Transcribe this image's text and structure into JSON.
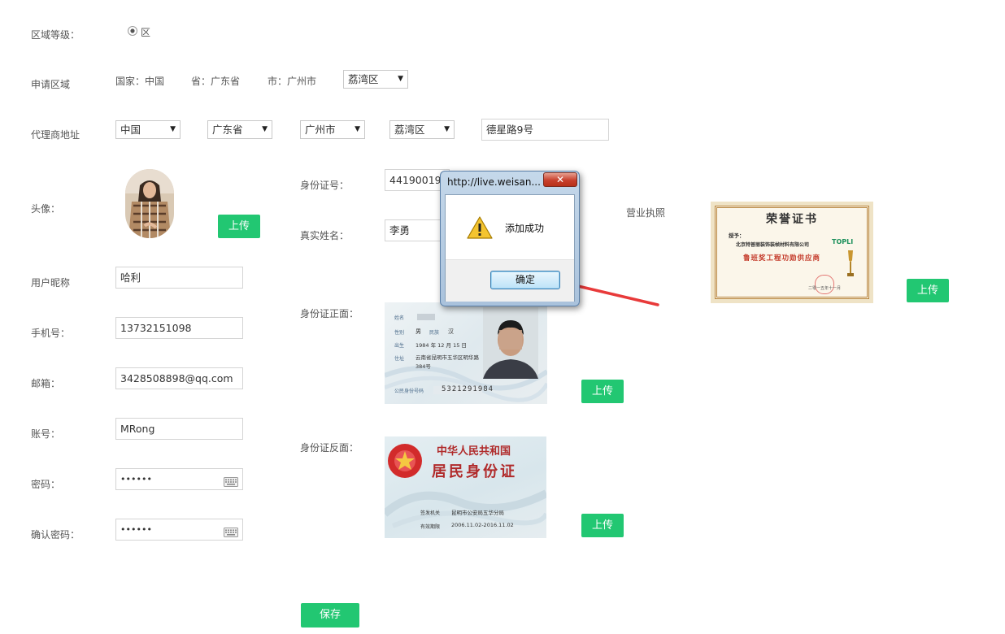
{
  "form": {
    "region_level_label": "区域等级：",
    "region_level_option": "区",
    "apply_region_label": "申请区域",
    "apply_country": "国家：中国",
    "apply_province": "省：广东省",
    "apply_city": "市：广州市",
    "apply_district": "荔湾区",
    "address_label": "代理商地址",
    "address_country": "中国",
    "address_province": "广东省",
    "address_city": "广州市",
    "address_district": "荔湾区",
    "address_street": "德星路9号",
    "avatar_label": "头像：",
    "upload_label": "上传",
    "nickname_label": "用户昵称",
    "nickname_value": "哈利",
    "phone_label": "手机号：",
    "phone_value": "13732151098",
    "email_label": "邮箱：",
    "email_value": "3428508898@qq.com",
    "account_label": "账号：",
    "account_value": "MRong",
    "password_label": "密码：",
    "password_value": "••••••",
    "confirm_password_label": "确认密码：",
    "confirm_password_value": "••••••",
    "id_number_label": "身份证号：",
    "id_number_value": "441900199",
    "real_name_label": "真实姓名：",
    "real_name_value": "李勇",
    "id_front_label": "身份证正面：",
    "id_back_label": "身份证反面：",
    "business_license_label": "营业执照",
    "save_label": "保存"
  },
  "id_front": {
    "name_field": "姓名",
    "sex_field": "性别",
    "sex_value": "男",
    "ethnic_field": "民族",
    "ethnic_value": "汉",
    "birth_field": "出生",
    "birth_value": "1984 年 12 月 15 日",
    "address_field": "住址",
    "address_value": "云南省昆明市五华区明华路384号",
    "number_field": "公民身份号码",
    "number_value": "5321291984"
  },
  "id_back": {
    "title": "中华人民共和国",
    "subtitle": "居民身份证",
    "authority_field": "签发机关",
    "authority_value": "昆明市公安局五华分局",
    "valid_field": "有效期限",
    "valid_value": "2006.11.02-2016.11.02"
  },
  "certificate": {
    "title": "荣誉证书",
    "to": "授予：",
    "company": "北京特普丽装饰装帧材料有限公司",
    "brand": "TOPLI",
    "award": "鲁班奖工程功勋供应商",
    "footer": "二零一五年十一月"
  },
  "dialog": {
    "title": "http://live.weisan...",
    "message": "添加成功",
    "ok_label": "确定"
  },
  "colors": {
    "accent_green": "#22c772",
    "arrow_red": "#e83a3a",
    "dialog_border": "#5a7fa8"
  },
  "icons": {
    "radio": "radio-checked-icon",
    "keyboard": "keyboard-icon",
    "warning": "warning-icon",
    "close": "close-icon"
  }
}
